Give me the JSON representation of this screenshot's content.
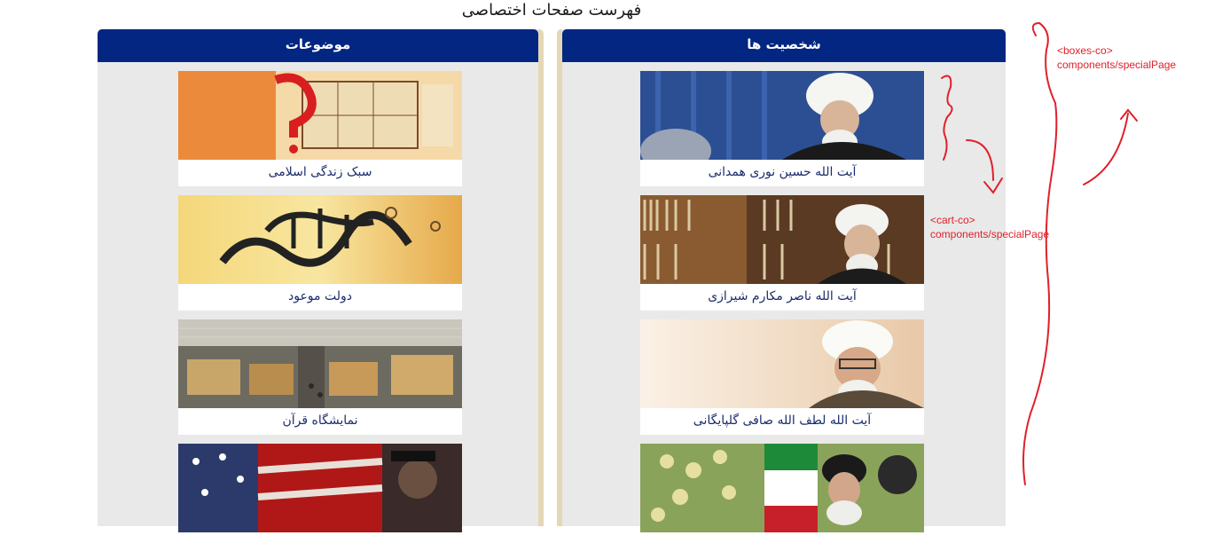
{
  "page": {
    "title": "فهرست صفحات اختصاصی"
  },
  "boxes": {
    "topics": {
      "title": "موضوعات",
      "cards": [
        {
          "label": "سبک زندگی اسلامی",
          "image": "floor-plan-image"
        },
        {
          "label": "دولت موعود",
          "image": "calligraphy-image"
        },
        {
          "label": "نمایشگاه قرآن",
          "image": "exhibition-hall-image"
        },
        {
          "label": "",
          "image": "daesh-flag-image"
        }
      ]
    },
    "personalities": {
      "title": "شخصیت ها",
      "cards": [
        {
          "label": "آیت الله حسین نوری همدانی",
          "image": "cleric-portrait-image"
        },
        {
          "label": "آیت الله ناصر مکارم شیرازی",
          "image": "cleric-library-image"
        },
        {
          "label": "آیت الله لطف الله صافی گلپایگانی",
          "image": "cleric-smiling-image"
        },
        {
          "label": "",
          "image": "cleric-flag-image"
        }
      ]
    }
  },
  "annotations": {
    "boxes": {
      "line1": "<boxes-co>",
      "line2": "components/specialPage"
    },
    "card": {
      "line1": "<cart-co>",
      "line2": "components/specialPage"
    }
  },
  "colors": {
    "header": "#022682",
    "border": "#e3d7b6",
    "panel": "#e9e9e9",
    "label": "#1a2d6b",
    "annotation": "#e0202a"
  }
}
